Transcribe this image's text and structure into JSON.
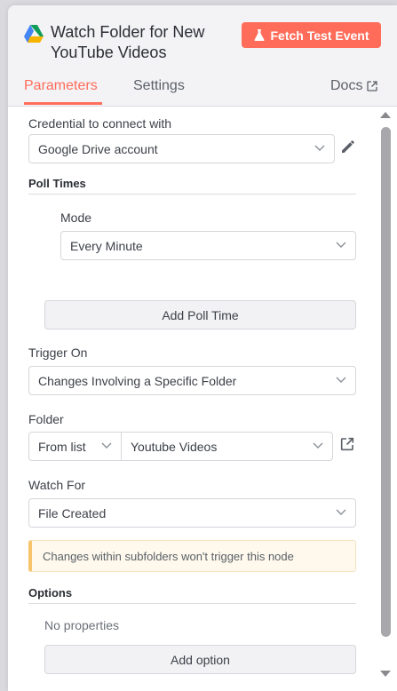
{
  "header": {
    "title": "Watch Folder for New YouTube Videos",
    "fetch_button": "Fetch Test Event",
    "tabs": [
      "Parameters",
      "Settings"
    ],
    "docs_link": "Docs"
  },
  "form": {
    "credential": {
      "label": "Credential to connect with",
      "value": "Google Drive account"
    },
    "poll_times": {
      "title": "Poll Times",
      "mode_label": "Mode",
      "mode_value": "Every Minute",
      "add_button": "Add Poll Time"
    },
    "trigger_on": {
      "label": "Trigger On",
      "value": "Changes Involving a Specific Folder"
    },
    "folder": {
      "label": "Folder",
      "source": "From list",
      "value": "Youtube Videos"
    },
    "watch_for": {
      "label": "Watch For",
      "value": "File Created"
    },
    "notice": "Changes within subfolders won't trigger this node",
    "options": {
      "title": "Options",
      "empty_text": "No properties",
      "add_button": "Add option"
    }
  },
  "colors": {
    "accent": "#ff6d5a",
    "notice_border": "#f7c46c",
    "notice_bg": "#fef9ec"
  },
  "icons": [
    "google-drive-icon",
    "flask-icon",
    "external-link-icon",
    "chevron-down-icon",
    "pencil-icon"
  ]
}
